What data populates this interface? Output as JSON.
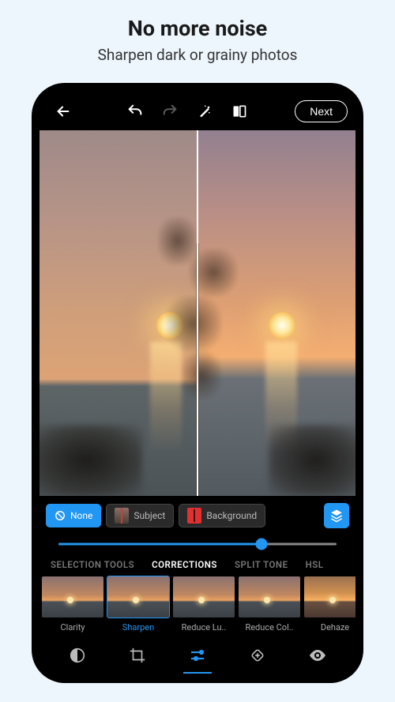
{
  "promo": {
    "title": "No more noise",
    "subtitle": "Sharpen dark or grainy photos"
  },
  "toolbar": {
    "next_label": "Next"
  },
  "masks": {
    "none": "None",
    "subject": "Subject",
    "background": "Background"
  },
  "slider": {
    "value": 73
  },
  "tabs": {
    "selection_tools": "SELECTION TOOLS",
    "corrections": "CORRECTIONS",
    "split_tone": "SPLIT TONE",
    "hsl": "HSL"
  },
  "corrections": {
    "clarity": "Clarity",
    "sharpen": "Sharpen",
    "reduce_luminance": "Reduce Lu..",
    "reduce_color": "Reduce Col..",
    "dehaze": "Dehaze"
  }
}
